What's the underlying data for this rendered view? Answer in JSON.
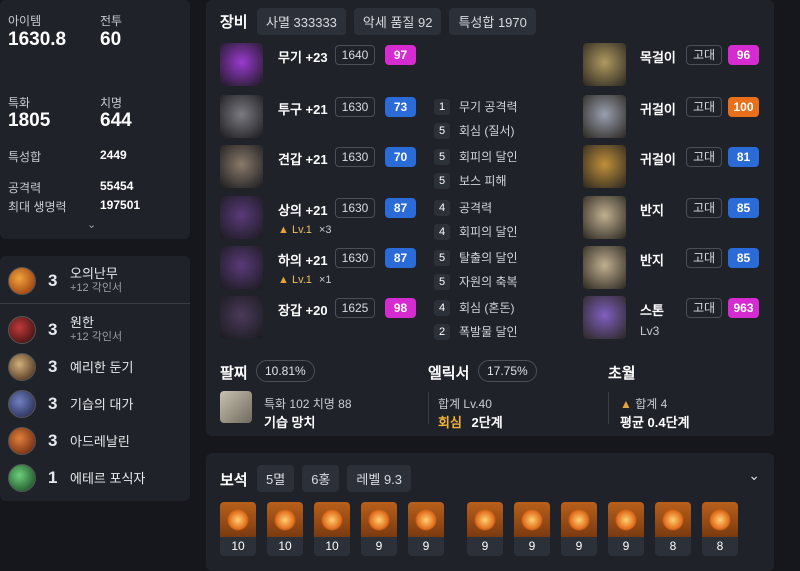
{
  "profile": {
    "item_level_label": "아이템",
    "item_level": "1630.8",
    "combat_label": "전투",
    "combat": "60",
    "special_label": "특화",
    "special": "1805",
    "crit_label": "치명",
    "crit": "644",
    "total_stat_label": "특성합",
    "total_stat": "2449",
    "attack_label": "공격력",
    "attack": "55454",
    "hp_label": "최대 생명력",
    "hp": "197501"
  },
  "engravings": [
    {
      "level": "3",
      "name": "오의난무",
      "sub": "+12 각인서",
      "icon": "fire-burst-icon"
    },
    {
      "level": "3",
      "name": "원한",
      "sub": "+12 각인서",
      "icon": "grudge-icon"
    },
    {
      "level": "3",
      "name": "예리한 둔기",
      "sub": "",
      "icon": "keen-blunt-icon"
    },
    {
      "level": "3",
      "name": "기습의 대가",
      "sub": "",
      "icon": "ambush-icon"
    },
    {
      "level": "3",
      "name": "아드레날린",
      "sub": "",
      "icon": "adrenaline-icon"
    },
    {
      "level": "1",
      "name": "에테르 포식자",
      "sub": "",
      "icon": "ether-icon"
    }
  ],
  "equip": {
    "title": "장비",
    "chips": [
      "사멸 333333",
      "악세 품질 92",
      "특성합 1970"
    ],
    "items": [
      {
        "name": "무기 +23",
        "level": "1640",
        "quality": "97",
        "color": "#d62bd0",
        "icon": "weapon-icon",
        "effects": []
      },
      {
        "name": "투구 +21",
        "level": "1630",
        "quality": "73",
        "color": "#2a6bd8",
        "icon": "helmet-icon",
        "effects": [
          [
            "1",
            "무기 공격력"
          ],
          [
            "5",
            "회심 (질서)"
          ]
        ]
      },
      {
        "name": "견갑 +21",
        "level": "1630",
        "quality": "70",
        "color": "#2a6bd8",
        "icon": "shoulder-icon",
        "effects": [
          [
            "5",
            "회피의 달인"
          ],
          [
            "5",
            "보스 피해"
          ]
        ]
      },
      {
        "name": "상의 +21",
        "level": "1630",
        "quality": "87",
        "color": "#2a6bd8",
        "icon": "chest-icon",
        "sub": "Lv.1",
        "mult": "×3",
        "effects": [
          [
            "4",
            "공격력"
          ],
          [
            "4",
            "회피의 달인"
          ]
        ]
      },
      {
        "name": "하의 +21",
        "level": "1630",
        "quality": "87",
        "color": "#2a6bd8",
        "icon": "pants-icon",
        "sub": "Lv.1",
        "mult": "×1",
        "effects": [
          [
            "5",
            "탈출의 달인"
          ],
          [
            "5",
            "자원의 축복"
          ]
        ]
      },
      {
        "name": "장갑 +20",
        "level": "1625",
        "quality": "98",
        "color": "#d62bd0",
        "icon": "gloves-icon",
        "effects": [
          [
            "4",
            "회심 (혼돈)"
          ],
          [
            "2",
            "폭발물 달인"
          ]
        ]
      }
    ],
    "acc": [
      {
        "name": "목걸이",
        "grade": "고대",
        "quality": "96",
        "color": "#d62bd0",
        "icon": "necklace-icon"
      },
      {
        "name": "귀걸이",
        "grade": "고대",
        "quality": "100",
        "color": "#e8701a",
        "icon": "earring-icon"
      },
      {
        "name": "귀걸이",
        "grade": "고대",
        "quality": "81",
        "color": "#2a6bd8",
        "icon": "earring-icon"
      },
      {
        "name": "반지",
        "grade": "고대",
        "quality": "85",
        "color": "#2a6bd8",
        "icon": "ring-icon"
      },
      {
        "name": "반지",
        "grade": "고대",
        "quality": "85",
        "color": "#2a6bd8",
        "icon": "ring-icon"
      },
      {
        "name": "스톤",
        "grade": "고대",
        "quality": "963",
        "color": "#d62bd0",
        "icon": "stone-icon",
        "sub": "Lv3"
      }
    ]
  },
  "bracelet": {
    "title": "팔찌",
    "pct": "10.81%",
    "line1": "특화 102  치명 88",
    "line2": "기습  망치"
  },
  "elixir": {
    "title": "엘릭서",
    "pct": "17.75%",
    "line1": "합계 Lv.40",
    "line2a": "회심",
    "line2b": "2단계"
  },
  "transcend": {
    "title": "초월",
    "line1": "합계 4",
    "line2": "평균 0.4단계"
  },
  "gems": {
    "title": "보석",
    "chips": [
      "5멸",
      "6홍",
      "레벨 9.3"
    ],
    "levels": [
      "10",
      "10",
      "10",
      "9",
      "9",
      "9",
      "9",
      "9",
      "9",
      "8",
      "8"
    ]
  }
}
